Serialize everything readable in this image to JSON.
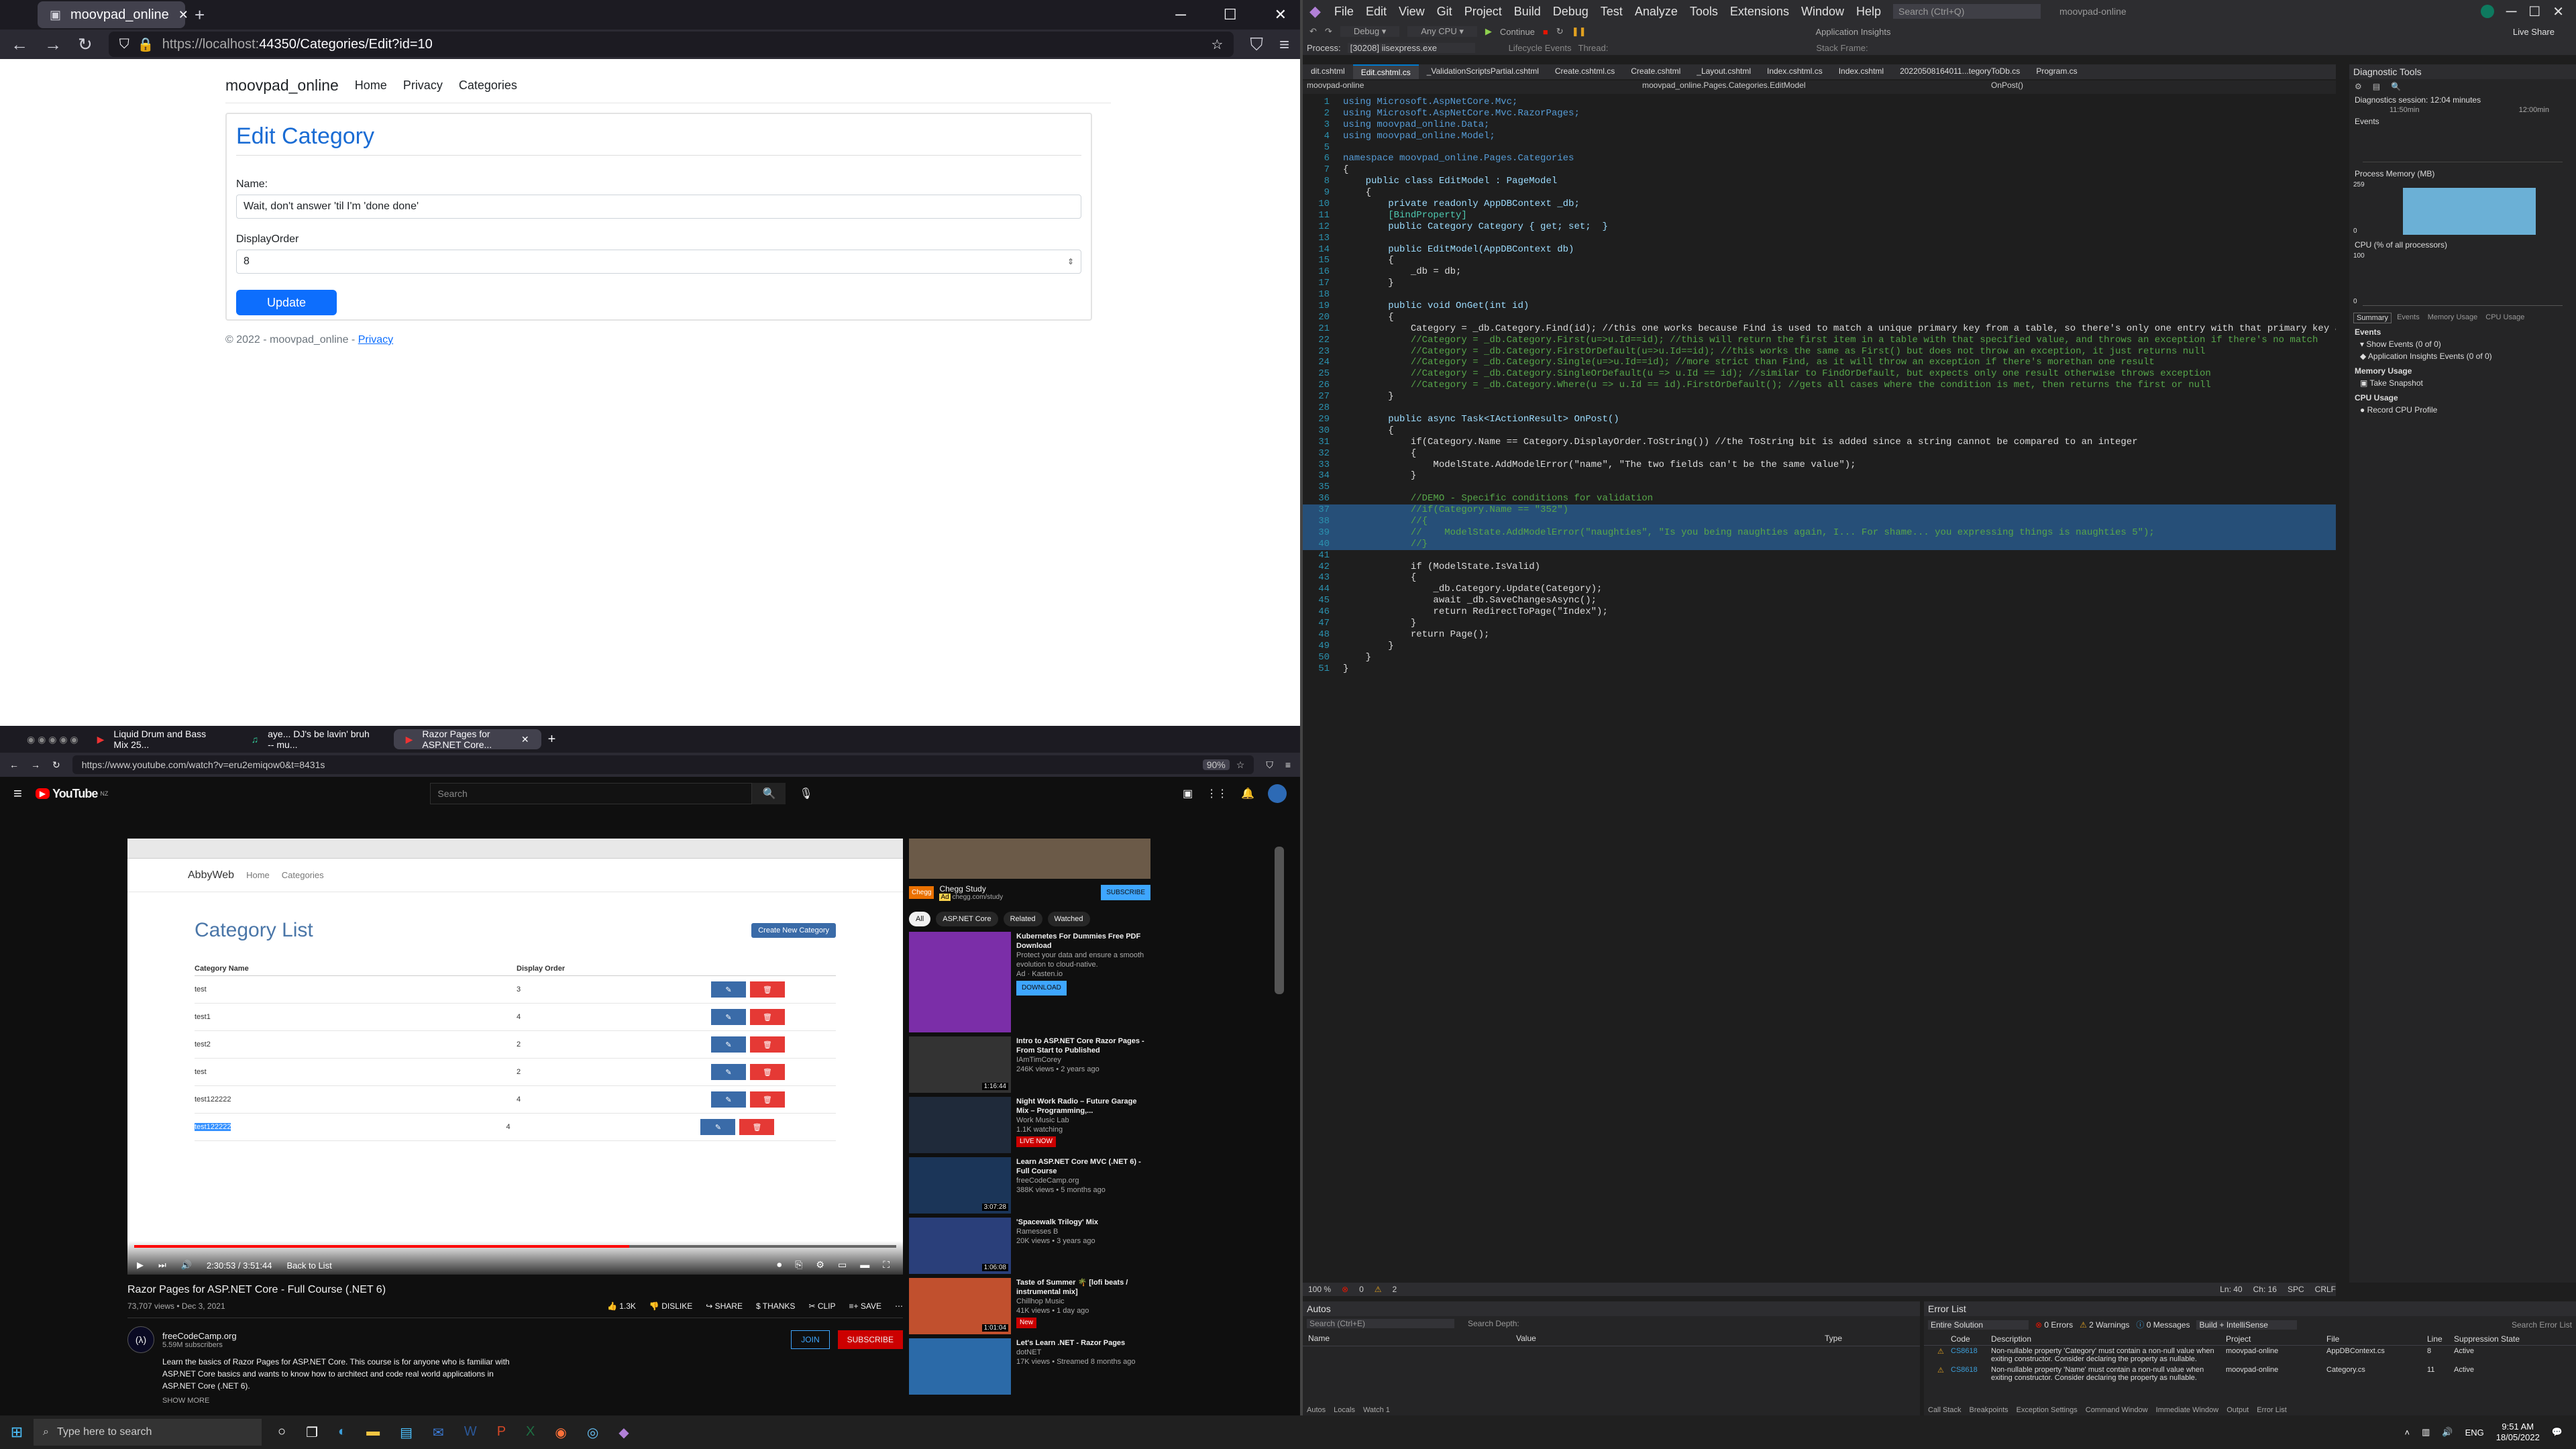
{
  "browser_top": {
    "tab_title": "moovpad_online",
    "url_host": "https://localhost:",
    "url_rest": "44350/Categories/Edit?id=10",
    "nav": {
      "brand": "moovpad_online",
      "links": [
        "Home",
        "Privacy",
        "Categories"
      ]
    },
    "form": {
      "title": "Edit Category",
      "name_label": "Name:",
      "name_value": "Wait, don't answer 'til I'm 'done done'",
      "order_label": "DisplayOrder",
      "order_value": "8",
      "update_label": "Update"
    },
    "footer_text": "© 2022 - moovpad_online - ",
    "footer_link": "Privacy"
  },
  "vs": {
    "menu": [
      "File",
      "Edit",
      "View",
      "Git",
      "Project",
      "Build",
      "Debug",
      "Test",
      "Analyze",
      "Tools",
      "Extensions",
      "Window",
      "Help"
    ],
    "search_placeholder": "Search (Ctrl+Q)",
    "solution_name": "moovpad-online",
    "live_share": "Live Share",
    "continue_label": "Continue",
    "app_insights": "Application Insights",
    "process_label": "Process:",
    "process_value": "[30208] iisexpress.exe",
    "lifecycle": "Lifecycle Events",
    "thread": "Thread:",
    "stack_frame": "Stack Frame:",
    "tabs": [
      "dit.cshtml",
      "Edit.cshtml.cs",
      "_ValidationScriptsPartial.cshtml",
      "Create.cshtml.cs",
      "Create.cshtml",
      "_Layout.cshtml",
      "Index.cshtml.cs",
      "Index.cshtml",
      "20220508164011...tegoryToDb.cs",
      "Program.cs"
    ],
    "nav_project": "moovpad-online",
    "nav_class": "moovpad_online.Pages.Categories.EditModel",
    "nav_member": "OnPost()",
    "code_lines": [
      {
        "n": "1",
        "t": "using Microsoft.AspNetCore.Mvc;"
      },
      {
        "n": "2",
        "t": "using Microsoft.AspNetCore.Mvc.RazorPages;"
      },
      {
        "n": "3",
        "t": "using moovpad_online.Data;"
      },
      {
        "n": "4",
        "t": "using moovpad_online.Model;"
      },
      {
        "n": "5",
        "t": ""
      },
      {
        "n": "6",
        "t": "namespace moovpad_online.Pages.Categories"
      },
      {
        "n": "7",
        "t": "{"
      },
      {
        "n": "8",
        "t": "    public class EditModel : PageModel"
      },
      {
        "n": "9",
        "t": "    {"
      },
      {
        "n": "10",
        "t": "        private readonly AppDBContext _db;"
      },
      {
        "n": "11",
        "t": "        [BindProperty]"
      },
      {
        "n": "12",
        "t": "        public Category Category { get; set;  }"
      },
      {
        "n": "13",
        "t": ""
      },
      {
        "n": "14",
        "t": "        public EditModel(AppDBContext db)"
      },
      {
        "n": "15",
        "t": "        {"
      },
      {
        "n": "16",
        "t": "            _db = db;"
      },
      {
        "n": "17",
        "t": "        }"
      },
      {
        "n": "18",
        "t": ""
      },
      {
        "n": "19",
        "t": "        public void OnGet(int id)"
      },
      {
        "n": "20",
        "t": "        {"
      },
      {
        "n": "21",
        "t": "            Category = _db.Category.Find(id); //this one works because Find is used to match a unique primary key from a table, so there's only one entry with that primary key as it's ID"
      },
      {
        "n": "22",
        "t": "            //Category = _db.Category.First(u=>u.Id==id); //this will return the first item in a table with that specified value, and throws an exception if there's no match"
      },
      {
        "n": "23",
        "t": "            //Category = _db.Category.FirstOrDefault(u=>u.Id==id); //this works the same as First() but does not throw an exception, it just returns null"
      },
      {
        "n": "24",
        "t": "            //Category = _db.Category.Single(u=>u.Id==id); //more strict than Find, as it will throw an exception if there's morethan one result"
      },
      {
        "n": "25",
        "t": "            //Category = _db.Category.SingleOrDefault(u => u.Id == id); //similar to FindOrDefault, but expects only one result otherwise throws exception"
      },
      {
        "n": "26",
        "t": "            //Category = _db.Category.Where(u => u.Id == id).FirstOrDefault(); //gets all cases where the condition is met, then returns the first or null"
      },
      {
        "n": "27",
        "t": "        }"
      },
      {
        "n": "28",
        "t": ""
      },
      {
        "n": "29",
        "t": "        public async Task<IActionResult> OnPost()"
      },
      {
        "n": "30",
        "t": "        {"
      },
      {
        "n": "31",
        "t": "            if(Category.Name == Category.DisplayOrder.ToString()) //the ToString bit is added since a string cannot be compared to an integer"
      },
      {
        "n": "32",
        "t": "            {"
      },
      {
        "n": "33",
        "t": "                ModelState.AddModelError(\"name\", \"The two fields can't be the same value\");"
      },
      {
        "n": "34",
        "t": "            }"
      },
      {
        "n": "35",
        "t": ""
      },
      {
        "n": "36",
        "t": "            //DEMO - Specific conditions for validation"
      },
      {
        "n": "37",
        "t": "            //if(Category.Name == \"352\")"
      },
      {
        "n": "38",
        "t": "            //{"
      },
      {
        "n": "39",
        "t": "            //    ModelState.AddModelError(\"naughties\", \"Is you being naughties again, I... For shame... you expressing things is naughties 5\");"
      },
      {
        "n": "40",
        "t": "            //}"
      },
      {
        "n": "41",
        "t": ""
      },
      {
        "n": "42",
        "t": "            if (ModelState.IsValid)"
      },
      {
        "n": "43",
        "t": "            {"
      },
      {
        "n": "44",
        "t": "                _db.Category.Update(Category);"
      },
      {
        "n": "45",
        "t": "                await _db.SaveChangesAsync();"
      },
      {
        "n": "46",
        "t": "                return RedirectToPage(\"Index\");"
      },
      {
        "n": "47",
        "t": "            }"
      },
      {
        "n": "48",
        "t": "            return Page();"
      },
      {
        "n": "49",
        "t": "        }"
      },
      {
        "n": "50",
        "t": "    }"
      },
      {
        "n": "51",
        "t": "}"
      }
    ],
    "status": {
      "zoom": "100 %",
      "errors": "0",
      "warnings": "2",
      "ln": "Ln: 40",
      "ch": "Ch: 16",
      "spc": "SPC",
      "crlf": "CRLF"
    },
    "diag": {
      "title": "Diagnostic Tools",
      "session": "Diagnostics session: 12:04 minutes",
      "t1": "11:50min",
      "t2": "12:00min",
      "events": "Events",
      "process_memory": "Process Memory (MB)",
      "mem_max": "259",
      "mem_min": "0",
      "cpu": "CPU (% of all processors)",
      "cpu_max": "100",
      "cpu_min": "0",
      "tabs": [
        "Summary",
        "Events",
        "Memory Usage",
        "CPU Usage"
      ],
      "ev_head": "Events",
      "show_events": "Show Events (0 of 0)",
      "ai_events": "Application Insights Events (0 of 0)",
      "mem_head": "Memory Usage",
      "snapshot": "Take Snapshot",
      "cpu_head": "CPU Usage",
      "record": "Record CPU Profile"
    },
    "autos": {
      "title": "Autos",
      "search": "Search (Ctrl+E)",
      "depth": "Search Depth:",
      "cols": [
        "Name",
        "Value",
        "Type"
      ],
      "tabs": [
        "Autos",
        "Locals",
        "Watch 1"
      ]
    },
    "errors": {
      "title": "Error List",
      "scope": "Entire Solution",
      "err": "0 Errors",
      "warn": "2 Warnings",
      "msg": "0 Messages",
      "build": "Build + IntelliSense",
      "search": "Search Error List",
      "cols": [
        "Code",
        "Description",
        "Project",
        "File",
        "Line",
        "Suppression State"
      ],
      "rows": [
        {
          "code": "CS8618",
          "desc": "Non-nullable property 'Category' must contain a non-null value when exiting constructor. Consider declaring the property as nullable.",
          "project": "moovpad-online",
          "file": "AppDBContext.cs",
          "line": "8",
          "state": "Active"
        },
        {
          "code": "CS8618",
          "desc": "Non-nullable property 'Name' must contain a non-null value when exiting constructor. Consider declaring the property as nullable.",
          "project": "moovpad-online",
          "file": "Category.cs",
          "line": "11",
          "state": "Active"
        }
      ],
      "bottom_tabs": [
        "Call Stack",
        "Breakpoints",
        "Exception Settings",
        "Command Window",
        "Immediate Window",
        "Output",
        "Error List"
      ]
    }
  },
  "browser_bottom": {
    "tabs": [
      "Liquid Drum and Bass Mix 25...",
      "aye... DJ's be lavin' bruh -- mu...",
      "Razor Pages for ASP.NET Core..."
    ],
    "url": "https://www.youtube.com/watch?v=eru2emiqow0&t=8431s",
    "zoom": "90%",
    "logo": "YouTube",
    "logo_sup": "NZ",
    "search_placeholder": "Search",
    "video": {
      "brand": "AbbyWeb",
      "nav": [
        "Home",
        "Categories"
      ],
      "heading": "Category List",
      "create_btn": "Create New Category",
      "col1": "Category Name",
      "col2": "Display Order",
      "rows": [
        {
          "name": "test",
          "order": "3"
        },
        {
          "name": "test1",
          "order": "4"
        },
        {
          "name": "test2",
          "order": "2"
        },
        {
          "name": "test",
          "order": "2"
        },
        {
          "name": "test122222",
          "order": "4"
        },
        {
          "name": "test122222",
          "order": "4"
        }
      ],
      "time": "2:30:53 / 3:51:44",
      "chapter": "Back to List"
    },
    "title": "Razor Pages for ASP.NET Core - Full Course (.NET 6)",
    "views": "73,707 views • Dec 3, 2021",
    "likes": "1.3K",
    "actions": [
      "DISLIKE",
      "SHARE",
      "THANKS",
      "CLIP",
      "SAVE"
    ],
    "channel": "freeCodeCamp.org",
    "subs": "5.59M subscribers",
    "join": "JOIN",
    "subscribe": "SUBSCRIBE",
    "desc1": "Learn the basics of Razor Pages for ASP.NET Core. This course is for anyone who is familiar with",
    "desc2": "ASP.NET Core basics and wants to know how to architect and code real world applications in",
    "desc3": "ASP.NET Core (.NET 6).",
    "show_more": "SHOW MORE",
    "ad": {
      "title": "Chegg Study",
      "tag": "Ad",
      "domain": "chegg.com/study",
      "btn": "SUBSCRIBE"
    },
    "chips": [
      "All",
      "ASP.NET Core",
      "Related",
      "Watched"
    ],
    "recs": [
      {
        "title": "Kubernetes For Dummies Free PDF Download",
        "sub": "Protect your data and ensure a smooth evolution to cloud-native.",
        "meta": "Ad · Kasten.io",
        "extra": "DOWNLOAD",
        "thumb": "#7b2ea8",
        "dur": ""
      },
      {
        "title": "Intro to ASP.NET Core Razor Pages - From Start to Published",
        "sub": "IAmTimCorey",
        "meta": "246K views • 2 years ago",
        "extra": "",
        "thumb": "#333333",
        "dur": "1:16:44"
      },
      {
        "title": "Night Work Radio – Future Garage Mix – Programming,...",
        "sub": "Work Music Lab",
        "meta": "1.1K watching",
        "extra": "LIVE NOW",
        "thumb": "#1f2a3a",
        "dur": ""
      },
      {
        "title": "Learn ASP.NET Core MVC (.NET 6) - Full Course",
        "sub": "freeCodeCamp.org",
        "meta": "388K views • 5 months ago",
        "extra": "",
        "thumb": "#1b3558",
        "dur": "3:07:28"
      },
      {
        "title": "'Spacewalk Trilogy' Mix",
        "sub": "Ramesses B",
        "meta": "20K views • 3 years ago",
        "extra": "",
        "thumb": "#2a3f7a",
        "dur": "1:06:08"
      },
      {
        "title": "Taste of Summer 🌴 [lofi beats / instrumental mix]",
        "sub": "Chillhop Music",
        "meta": "41K views • 1 day ago",
        "extra": "New",
        "thumb": "#c1502e",
        "dur": "1:01:04"
      },
      {
        "title": "Let's Learn .NET - Razor Pages",
        "sub": "dotNET",
        "meta": "17K views • Streamed 8 months ago",
        "extra": "",
        "thumb": "#2b6aa8",
        "dur": ""
      }
    ]
  },
  "taskbar": {
    "search": "Type here to search",
    "time": "9:51 AM",
    "date": "18/05/2022",
    "lang": "ENG"
  }
}
